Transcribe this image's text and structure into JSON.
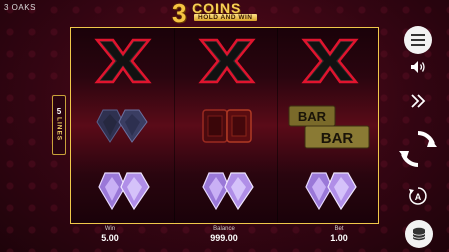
{
  "studio": "3 OAKS",
  "logo": {
    "number": "3",
    "word": "COINS",
    "subtitle": "HOLD AND WIN"
  },
  "lines": {
    "count": "5",
    "label": "LINES"
  },
  "reels": [
    [
      "x",
      "blue-diamonds",
      "purple-diamonds"
    ],
    [
      "x",
      "red-rubies",
      "purple-diamonds"
    ],
    [
      "x",
      "bar-bar",
      "purple-diamonds"
    ]
  ],
  "symbols": {
    "bar_text": "BAR"
  },
  "stats": {
    "win_label": "Win",
    "win_value": "5.00",
    "balance_label": "Balance",
    "balance_value": "999.00",
    "bet_label": "Bet",
    "bet_value": "1.00"
  },
  "colors": {
    "accent_gold": "#f0c84a",
    "x_red": "#e0142e"
  }
}
